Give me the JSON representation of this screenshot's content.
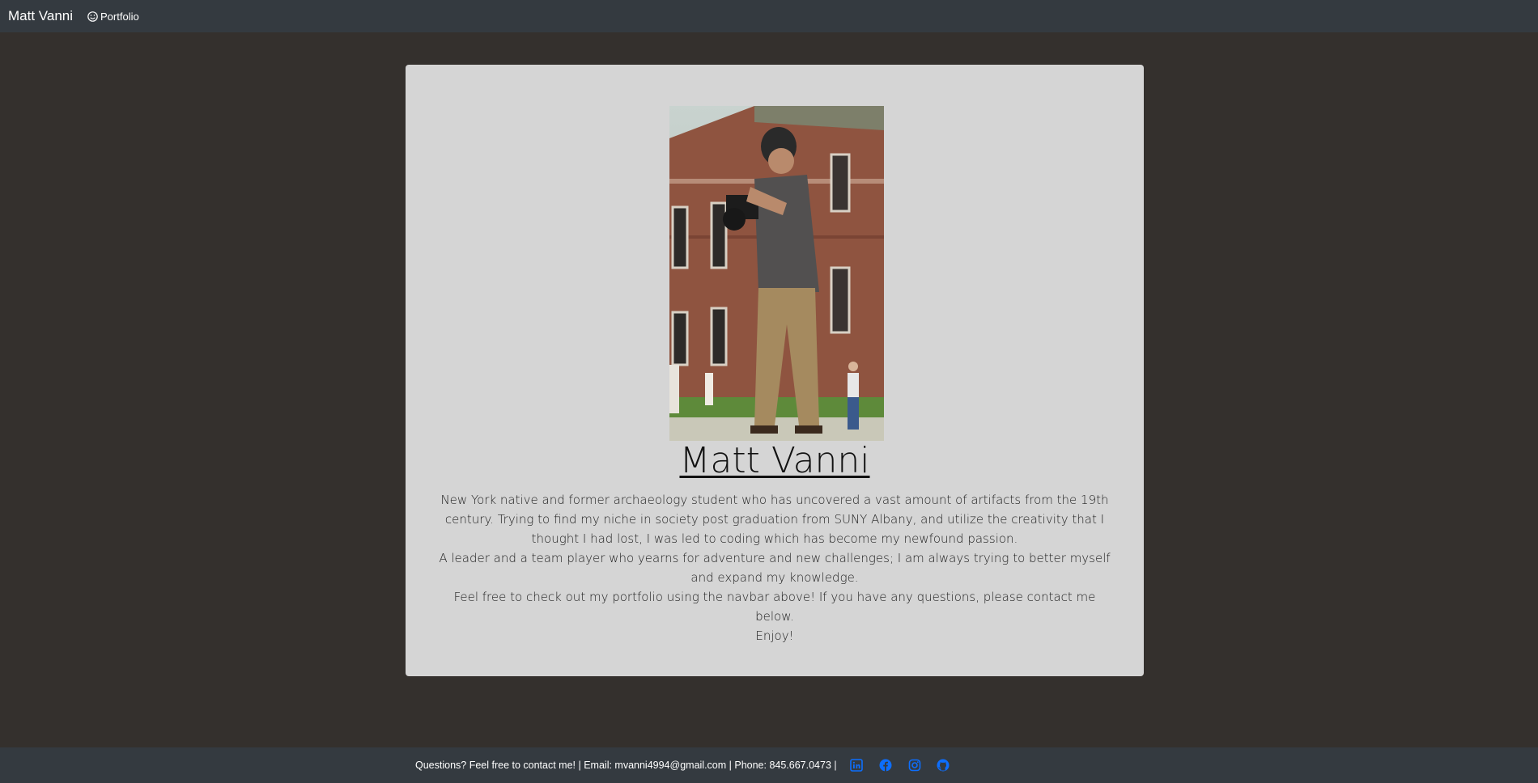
{
  "navbar": {
    "brand": "Matt Vanni",
    "portfolio_label": "Portfolio",
    "portfolio_icon": "smile-icon"
  },
  "profile": {
    "name": "Matt Vanni",
    "photo_description": "photo-icon",
    "bio": [
      "New York native and former archaeology student who has uncovered a vast amount of artifacts from the 19th century. Trying to find my niche in society post graduation from SUNY Albany, and utilize the creativity that I thought I had lost, I was led to coding which has become my newfound passion.",
      "A leader and a team player who yearns for adventure and new challenges; I am always trying to better myself and expand my knowledge.",
      "Feel free to check out my portfolio using the navbar above! If you have any questions, please contact me below.",
      "Enjoy!"
    ]
  },
  "footer": {
    "contact_text": "Questions? Feel free to contact me! | Email: mvanni4994@gmail.com | Phone: 845.667.0473 |",
    "social_links": [
      {
        "icon": "linkedin-icon"
      },
      {
        "icon": "facebook-icon"
      },
      {
        "icon": "instagram-icon"
      },
      {
        "icon": "github-icon"
      }
    ],
    "social_color": "#0d6efd"
  },
  "colors": {
    "page_background": "#34302d",
    "navbar_background": "#343a40",
    "card_background": "#d5d5d5"
  }
}
